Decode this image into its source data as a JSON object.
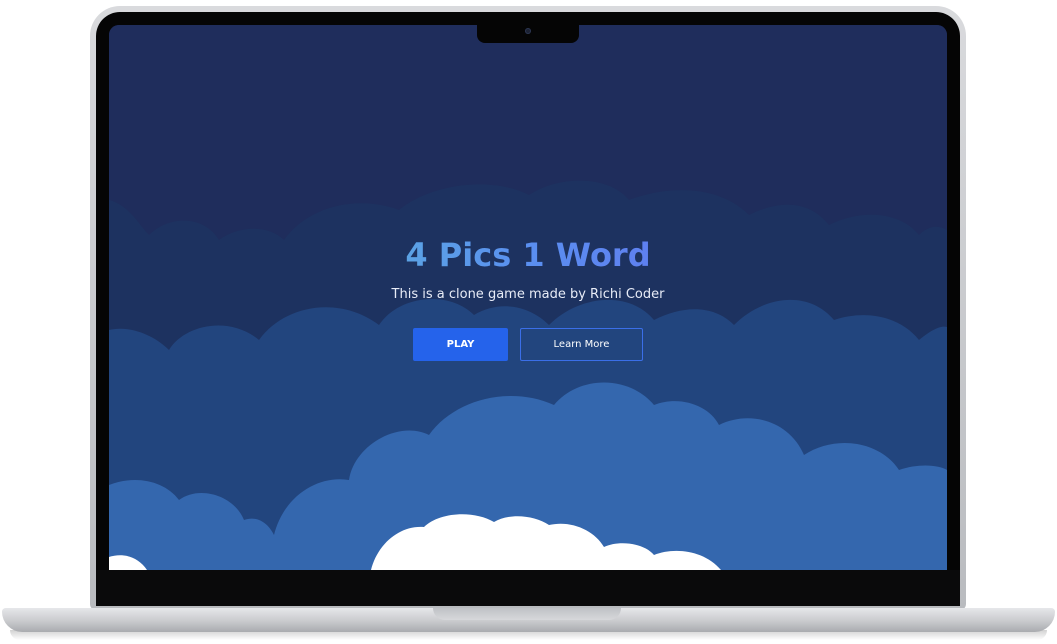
{
  "app": {
    "title": "4 Pics 1 Word",
    "subtitle": "This is a clone game made by Richi Coder"
  },
  "buttons": {
    "play_label": "PLAY",
    "learn_more_label": "Learn More"
  },
  "colors": {
    "sky": "#1f2d5c",
    "cloud_far": "#1d3260",
    "cloud_mid": "#22457e",
    "cloud_near": "#3467ae",
    "cloud_front": "#ffffff",
    "play_button": "#2563eb",
    "title_gradient": [
      "#5ed0c8",
      "#5a8ff0",
      "#6a5cf0"
    ]
  },
  "icons": [
    "camera-icon"
  ]
}
